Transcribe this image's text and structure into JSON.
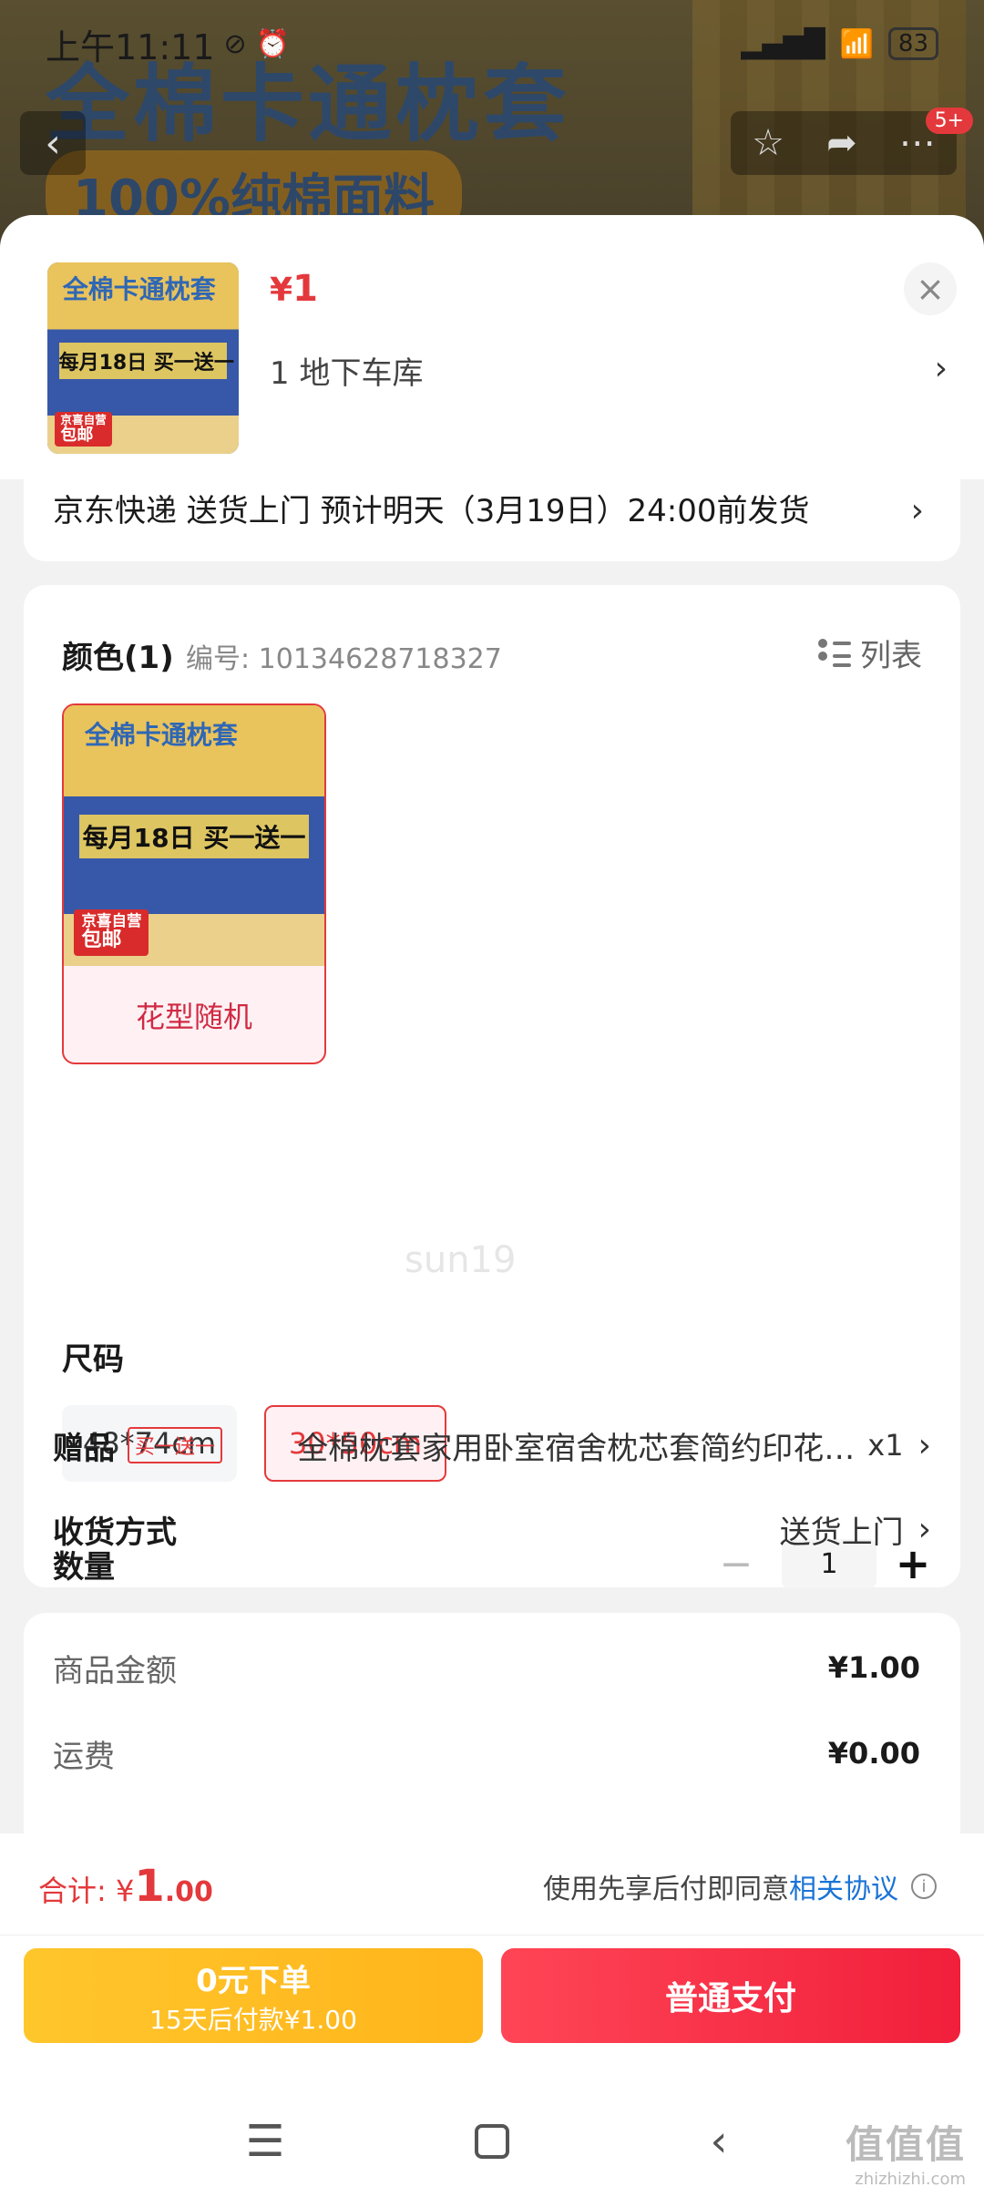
{
  "status_bar": {
    "time": "上午11:11",
    "icons": [
      "mute-icon",
      "alarm-icon",
      "signal-icon",
      "wifi-icon"
    ],
    "battery": "83"
  },
  "background": {
    "banner_title": "全棉卡通枕套",
    "banner_sub": "100%纯棉面料",
    "badge": "5+"
  },
  "product": {
    "image": {
      "title": "全棉卡通枕套",
      "promo": "每月18日 买一送一",
      "tag_line1": "京喜自营",
      "tag_line2": "包邮",
      "sub": "100%纯棉面料"
    },
    "currency": "¥",
    "price": "1",
    "address": "1  地下车库"
  },
  "shipping": {
    "text": "京东快递 送货上门 预计明天（3月19日）24:00前发货"
  },
  "color": {
    "label": "颜色(1)",
    "code": "编号: 10134628718327",
    "list_label": "列表",
    "option_label": "花型随机"
  },
  "watermark": "sun19",
  "size": {
    "label": "尺码",
    "options": [
      "48*74cm",
      "30*50cm"
    ],
    "selected": "30*50cm"
  },
  "quantity": {
    "label": "数量",
    "minus": "−",
    "value": "1",
    "plus": "+"
  },
  "gift": {
    "label": "赠品",
    "tag": "买一送一",
    "text": "全棉枕套家用卧室宿舍枕芯套简约印花单人枕头套单只装",
    "count": "x1"
  },
  "delivery": {
    "label": "收货方式",
    "value": "送货上门"
  },
  "fees": {
    "goods_label": "商品金额",
    "goods_value": "¥1.00",
    "freight_label": "运费",
    "freight_value": "¥0.00"
  },
  "footer": {
    "total_label": "合计:",
    "currency": "¥",
    "total_int": "1",
    "total_dec": ".00",
    "agree_prefix": "使用先享后付即同意",
    "agree_link": "相关协议",
    "pay_later_line1": "0元下单",
    "pay_later_line2": "15天后付款¥1.00",
    "pay_label": "普通支付"
  },
  "site_mark": {
    "m1": "值值值",
    "m2": "zhizhizhi.com"
  },
  "colors": {
    "accent": "#e4393c",
    "pay_later": "#ffbb22",
    "link": "#1a73d6"
  }
}
